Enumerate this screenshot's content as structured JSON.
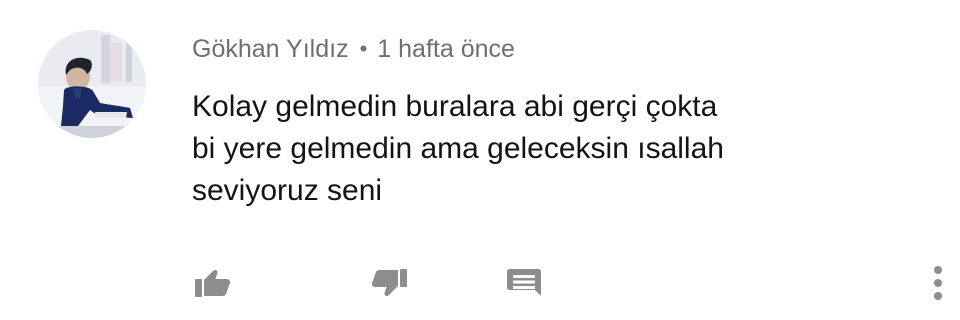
{
  "comment": {
    "author": "Gökhan Yıldız",
    "separator": "•",
    "time": "1 hafta önce",
    "text_lines": [
      "Kolay gelmedin buralara abi gerçi çokta",
      "bi yere gelmedin ama geleceksin ısallah",
      "seviyoruz seni"
    ]
  },
  "actions": {
    "like_icon": "thumbs-up-icon",
    "dislike_icon": "thumbs-down-icon",
    "reply_icon": "comment-icon",
    "more_icon": "more-vertical-icon"
  },
  "colors": {
    "background": "#ffffff",
    "meta_text": "#6f6f6f",
    "comment_text": "#141414",
    "icon": "#8d8d8d"
  }
}
